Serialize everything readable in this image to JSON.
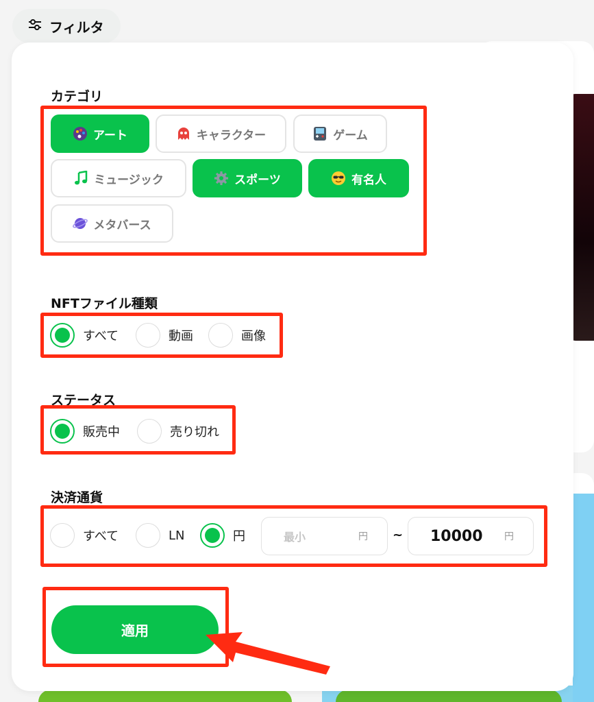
{
  "filter_button": {
    "label": "フィルタ",
    "icon": "sliders-icon"
  },
  "category": {
    "title": "カテゴリ",
    "chips": [
      {
        "label": "アート",
        "icon": "palette-icon",
        "selected": true
      },
      {
        "label": "キャラクター",
        "icon": "ghost-icon",
        "selected": false
      },
      {
        "label": "ゲーム",
        "icon": "gameboy-icon",
        "selected": false
      },
      {
        "label": "ミュージック",
        "icon": "music-note-icon",
        "selected": false
      },
      {
        "label": "スポーツ",
        "icon": "gear-icon",
        "selected": true
      },
      {
        "label": "有名人",
        "icon": "sunglasses-face-icon",
        "selected": true
      },
      {
        "label": "メタバース",
        "icon": "planet-icon",
        "selected": false
      }
    ]
  },
  "file_type": {
    "title": "NFTファイル種類",
    "options": [
      {
        "label": "すべて",
        "selected": true
      },
      {
        "label": "動画",
        "selected": false
      },
      {
        "label": "画像",
        "selected": false
      }
    ]
  },
  "status": {
    "title": "ステータス",
    "options": [
      {
        "label": "販売中",
        "selected": true
      },
      {
        "label": "売り切れ",
        "selected": false
      }
    ]
  },
  "currency": {
    "title": "決済通貨",
    "options": [
      {
        "label": "すべて",
        "selected": false
      },
      {
        "label": "LN",
        "selected": false
      },
      {
        "label": "円",
        "selected": true
      }
    ],
    "min": {
      "placeholder": "最小",
      "value": "",
      "unit": "円"
    },
    "separator": "~",
    "max": {
      "value": "10000",
      "unit": "円"
    }
  },
  "apply_button": {
    "label": "適用"
  },
  "colors": {
    "accent": "#09c24c",
    "highlight": "#ff2b12"
  }
}
